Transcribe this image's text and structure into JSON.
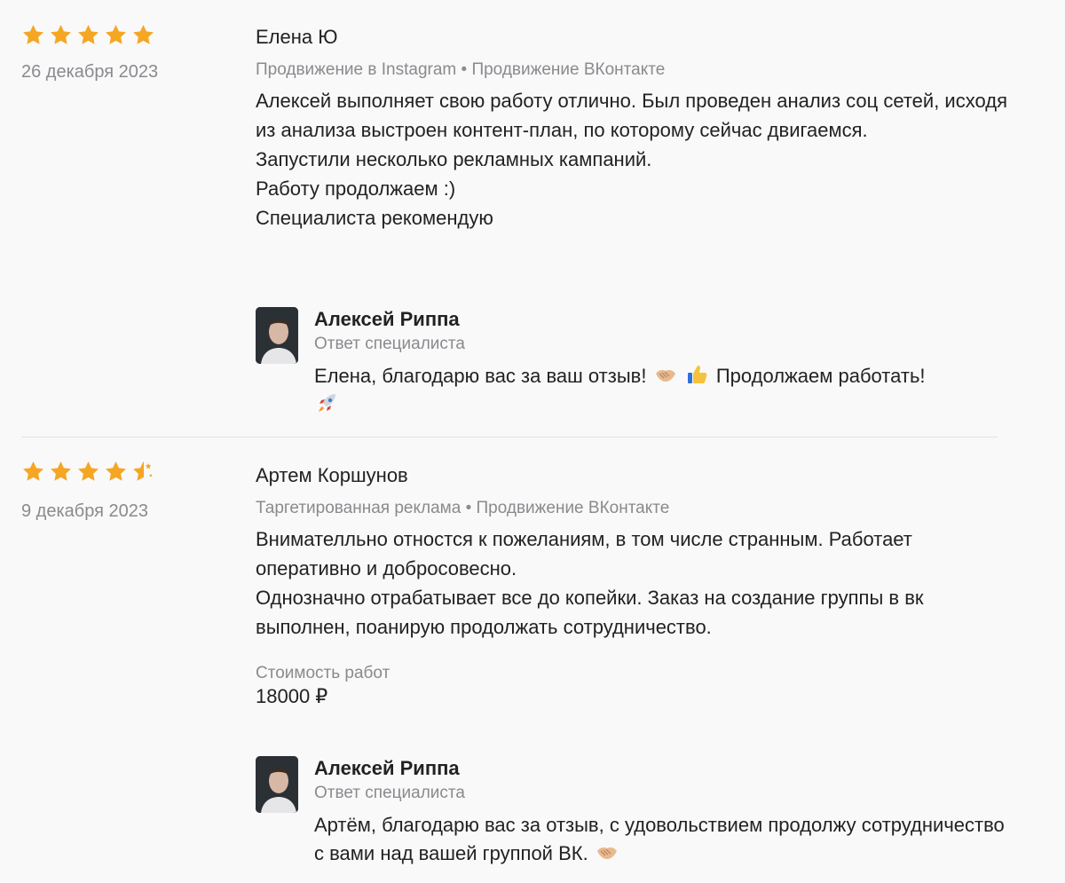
{
  "colors": {
    "star": "#f5a623",
    "muted_text": "#8a8a8f",
    "primary_text": "#222222",
    "divider": "#e2e2e4",
    "background": "#f9f9f9"
  },
  "reviews": [
    {
      "rating": 5,
      "date": "26 декабря 2023",
      "author": "Елена Ю",
      "services": "Продвижение в Instagram • Продвижение ВКонтакте",
      "text": "Алексей выполняет свою работу отлично. Был проведен анализ соц сетей, исходя из анализа выстроен контент-план, по которому сейчас двигаемся.\nЗапустили несколько рекламных кампаний.\nРаботу продолжаем :)\nСпециалиста рекомендую",
      "reply": {
        "name": "Алексей Риппа",
        "role": "Ответ специалиста",
        "text_before": "Елена, благодарю вас за ваш отзыв!",
        "emoji_1": "handshake-icon",
        "emoji_2": "thumbs-up-icon",
        "text_after": "Продолжаем работать!",
        "emoji_3": "rocket-icon"
      }
    },
    {
      "rating": 4.5,
      "date": "9 декабря 2023",
      "author": "Артем Коршунов",
      "services": "Таргетированная реклама • Продвижение ВКонтакте",
      "text": "Внимателльно отностся к пожеланиям, в том числе странным. Работает оперативно и добросовесно.\nОднозначно отрабатывает все до копейки. Заказ на создание группы в вк выполнен, поанирую продолжать сотрудничество.",
      "cost_label": "Стоимость работ",
      "cost_value": "18000 ₽",
      "reply": {
        "name": "Алексей Риппа",
        "role": "Ответ специалиста",
        "text": "Артём, благодарю вас за отзыв, с удовольствием продолжу сотрудничество с вами над вашей группой ВК.",
        "emoji_1": "handshake-icon"
      }
    }
  ]
}
